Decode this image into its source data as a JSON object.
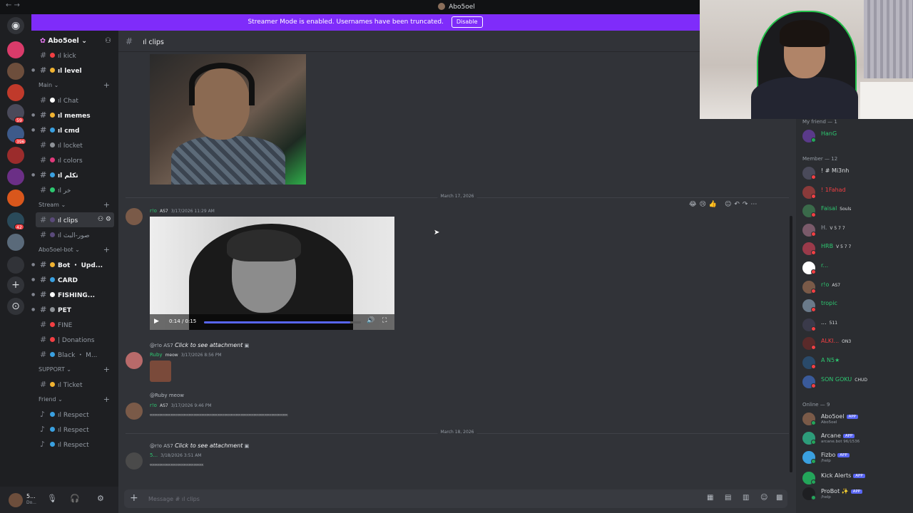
{
  "window": {
    "title": "Abo5oel"
  },
  "banner": {
    "text": "Streamer Mode is enabled. Usernames have been truncated.",
    "button": "Disable"
  },
  "rail": {
    "badges": [
      "59",
      "396",
      "42"
    ]
  },
  "server": {
    "name": "Abo5oel"
  },
  "channels": {
    "top": [
      {
        "label": "ıl kick"
      },
      {
        "label": "ıl level"
      }
    ],
    "cat_main": "Main",
    "main": [
      {
        "label": "ıl Chat"
      },
      {
        "label": "ıl memes"
      },
      {
        "label": "ıl cmd"
      },
      {
        "label": "ıl locket"
      },
      {
        "label": "ıl colors"
      },
      {
        "label": "ıl تكلم"
      },
      {
        "label": "ıl خر"
      }
    ],
    "cat_stream": "Stream",
    "stream": [
      {
        "label": "ıl clips"
      },
      {
        "label": "ıl صور-البث"
      }
    ],
    "cat_bot": "Abo5oel-bot",
    "bot": [
      {
        "label": "Bot ・ Upd..."
      },
      {
        "label": "CARD"
      },
      {
        "label": "FISHING..."
      },
      {
        "label": "PET"
      },
      {
        "label": "FINE"
      },
      {
        "label": "| Donations"
      },
      {
        "label": "Black ・ M..."
      }
    ],
    "cat_support": "SUPPORT",
    "support": [
      {
        "label": "ıl Ticket"
      }
    ],
    "cat_friend": "Friend",
    "friend": [
      {
        "label": "ıl Respect"
      },
      {
        "label": "ıl Respect"
      },
      {
        "label": "ıl Respect"
      }
    ]
  },
  "user": {
    "name": "5...",
    "status": "Do..."
  },
  "main": {
    "channel": "ıl clips",
    "date1": "March 17, 2026",
    "date2": "March 18, 2026",
    "msg1": {
      "name": "r!o",
      "tag": "AS7",
      "time": "3/17/2026 11:29 AM"
    },
    "video": {
      "time": "0:14 / 0:15",
      "progress": 0.93
    },
    "msg2": {
      "reply": "@r!o",
      "reply_tag": "AS7",
      "reply_text": "Click to see attachment",
      "name": "Ruby",
      "tag": "meow",
      "time": "3/17/2026 8:56 PM"
    },
    "msg3": {
      "reply": "@Ruby",
      "reply_tag": "meow",
      "name": "r!o",
      "tag": "AS7",
      "time": "3/17/2026 9:46 PM",
      "body": "ᶜᶜᶜᶜᶜᶜᶜᶜᶜᶜᶜᶜᶜᶜᶜᶜᶜᶜᶜᶜᶜᶜᶜᶜᶜᶜᶜᶜᶜᶜᶜᶜᶜᶜᶜᶜᶜᶜᶜᶜᶜᶜᶜᶜᶜᶜᶜᶜᶜᶜᶜᶜᶜᶜᶜᶜᶜᶜᶜᶜᶜᶜᶜᶜᶜᶜᶜᶜᶜᶜᶜᶜᶜᶜᶜᶜᶜᶜᶜᶜᶜᶜᶜᶜᶜ"
    },
    "msg4": {
      "reply": "@r!o",
      "reply_tag": "AS7",
      "reply_text": "Click to see attachment",
      "name": "5...",
      "time": "3/18/2026 3:51 AM",
      "body": "ᶜᶜᶜᶜᶜᶜᶜᶜᶜᶜᶜᶜᶜᶜᶜᶜᶜᶜᶜᶜᶜᶜᶜᶜᶜᶜᶜᶜᶜᶜᶜᶜᶜ"
    },
    "composer_placeholder": "Message # ıl clips"
  },
  "members": {
    "cat_friend": "My friend — 1",
    "cat_member": "Member — 12",
    "cat_online": "Online — 9",
    "friend": [
      {
        "name": "HanG",
        "color": "#2dc770"
      }
    ],
    "member": [
      {
        "name": "! # Mi3nh",
        "role": "",
        "sub": "",
        "color": "#dbdee1"
      },
      {
        "name": "! 1Fahad",
        "role": "",
        "sub": "",
        "color": "#f23f43"
      },
      {
        "name": "Faisal",
        "role": "Souls",
        "sub": "",
        "color": "#2dc770"
      },
      {
        "name": "H.",
        "role": "V 5 7 7",
        "sub": "",
        "color": "#949ba4"
      },
      {
        "name": "HRB",
        "role": "V 5 7 7",
        "sub": "",
        "color": "#2dc770"
      },
      {
        "name": "r...",
        "role": "",
        "sub": "",
        "color": "#2dc770"
      },
      {
        "name": "r!o",
        "role": "AS7",
        "sub": "",
        "color": "#2dc770"
      },
      {
        "name": "tropic",
        "role": "",
        "sub": "",
        "color": "#2dc770"
      },
      {
        "name": "...",
        "role": "511",
        "sub": "",
        "color": "#dbdee1"
      },
      {
        "name": "ALKI...",
        "role": "ON3",
        "sub": "",
        "color": "#f23f43"
      },
      {
        "name": "A N5★",
        "role": "",
        "sub": "",
        "color": "#2dc770"
      },
      {
        "name": "SON GOKU",
        "role": "CHUD",
        "sub": "",
        "color": "#2dc770"
      }
    ],
    "online": [
      {
        "name": "Abo5oel",
        "sub": "Abo5oel",
        "app": "APP"
      },
      {
        "name": "Arcane",
        "sub": "arcane.bot 96/1536",
        "app": "APP"
      },
      {
        "name": "Fizbo",
        "sub": "/help",
        "app": "APP"
      },
      {
        "name": "Kick Alerts",
        "sub": "",
        "app": "APP"
      },
      {
        "name": "ProBot ✨",
        "sub": "/help",
        "app": "APP"
      }
    ]
  }
}
